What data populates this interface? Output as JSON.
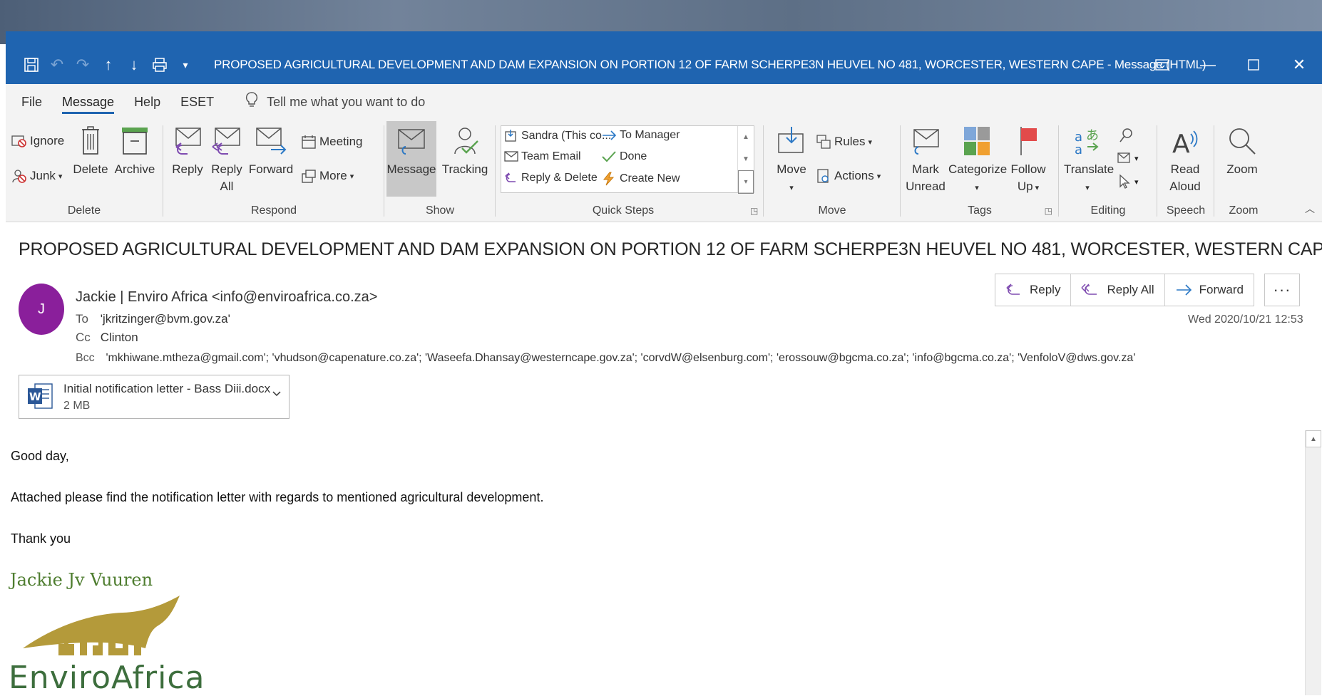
{
  "window": {
    "title": "PROPOSED AGRICULTURAL DEVELOPMENT AND DAM EXPANSION ON PORTION 12 OF FARM SCHERPE3N HEUVEL NO 481, WORCESTER, WESTERN CAPE  -  Message (HTML)",
    "accent": "#1f64b0"
  },
  "menu": {
    "tabs": [
      "File",
      "Message",
      "Help",
      "ESET"
    ],
    "active": "Message",
    "tellme": "Tell me what you want to do"
  },
  "ribbon": {
    "delete": {
      "label": "Delete",
      "ignore": "Ignore",
      "junk": "Junk",
      "delete_btn": "Delete",
      "archive": "Archive"
    },
    "respond": {
      "label": "Respond",
      "reply": "Reply",
      "reply_all_1": "Reply",
      "reply_all_2": "All",
      "forward": "Forward",
      "meeting": "Meeting",
      "more": "More"
    },
    "show": {
      "label": "Show",
      "message": "Message",
      "tracking": "Tracking"
    },
    "quicksteps": {
      "label": "Quick Steps",
      "items": [
        "Sandra (This co...",
        "Team Email",
        "Reply & Delete",
        "To Manager",
        "Done",
        "Create New"
      ]
    },
    "move": {
      "label": "Move",
      "move_btn": "Move",
      "rules": "Rules",
      "actions": "Actions"
    },
    "tags": {
      "label": "Tags",
      "mark_1": "Mark",
      "mark_2": "Unread",
      "categorize": "Categorize",
      "follow_1": "Follow",
      "follow_2": "Up"
    },
    "editing": {
      "label": "Editing",
      "translate": "Translate"
    },
    "speech": {
      "label": "Speech",
      "read_1": "Read",
      "read_2": "Aloud"
    },
    "zoom": {
      "label": "Zoom",
      "zoom_btn": "Zoom"
    }
  },
  "message": {
    "subject": "PROPOSED AGRICULTURAL DEVELOPMENT AND DAM EXPANSION ON PORTION 12 OF FARM SCHERPE3N HEUVEL NO 481, WORCESTER, WESTERN CAPE",
    "avatar_initial": "J",
    "sender": "Jackie | Enviro Africa <info@enviroafrica.co.za>",
    "to_label": "To",
    "to": "'jkritzinger@bvm.gov.za'",
    "cc_label": "Cc",
    "cc": "Clinton",
    "bcc_label": "Bcc",
    "bcc": "'mkhiwane.mtheza@gmail.com'; 'vhudson@capenature.co.za'; 'Waseefa.Dhansay@westerncape.gov.za'; 'corvdW@elsenburg.com'; 'erossouw@bgcma.co.za'; 'info@bgcma.co.za'; 'VenfoloV@dws.gov.za'",
    "datetime": "Wed 2020/10/21 12:53",
    "actions": {
      "reply": "Reply",
      "reply_all": "Reply All",
      "forward": "Forward",
      "more": "···"
    },
    "attachment": {
      "name": "Initial notification letter - Bass Diii.docx",
      "size": "2 MB"
    },
    "body": [
      "Good day,",
      "Attached please find the notification letter with regards to mentioned agricultural development.",
      "Thank you"
    ],
    "signature": {
      "name": "Jackie Jv Vuuren",
      "logo_text": "EnviroAfrica"
    }
  }
}
